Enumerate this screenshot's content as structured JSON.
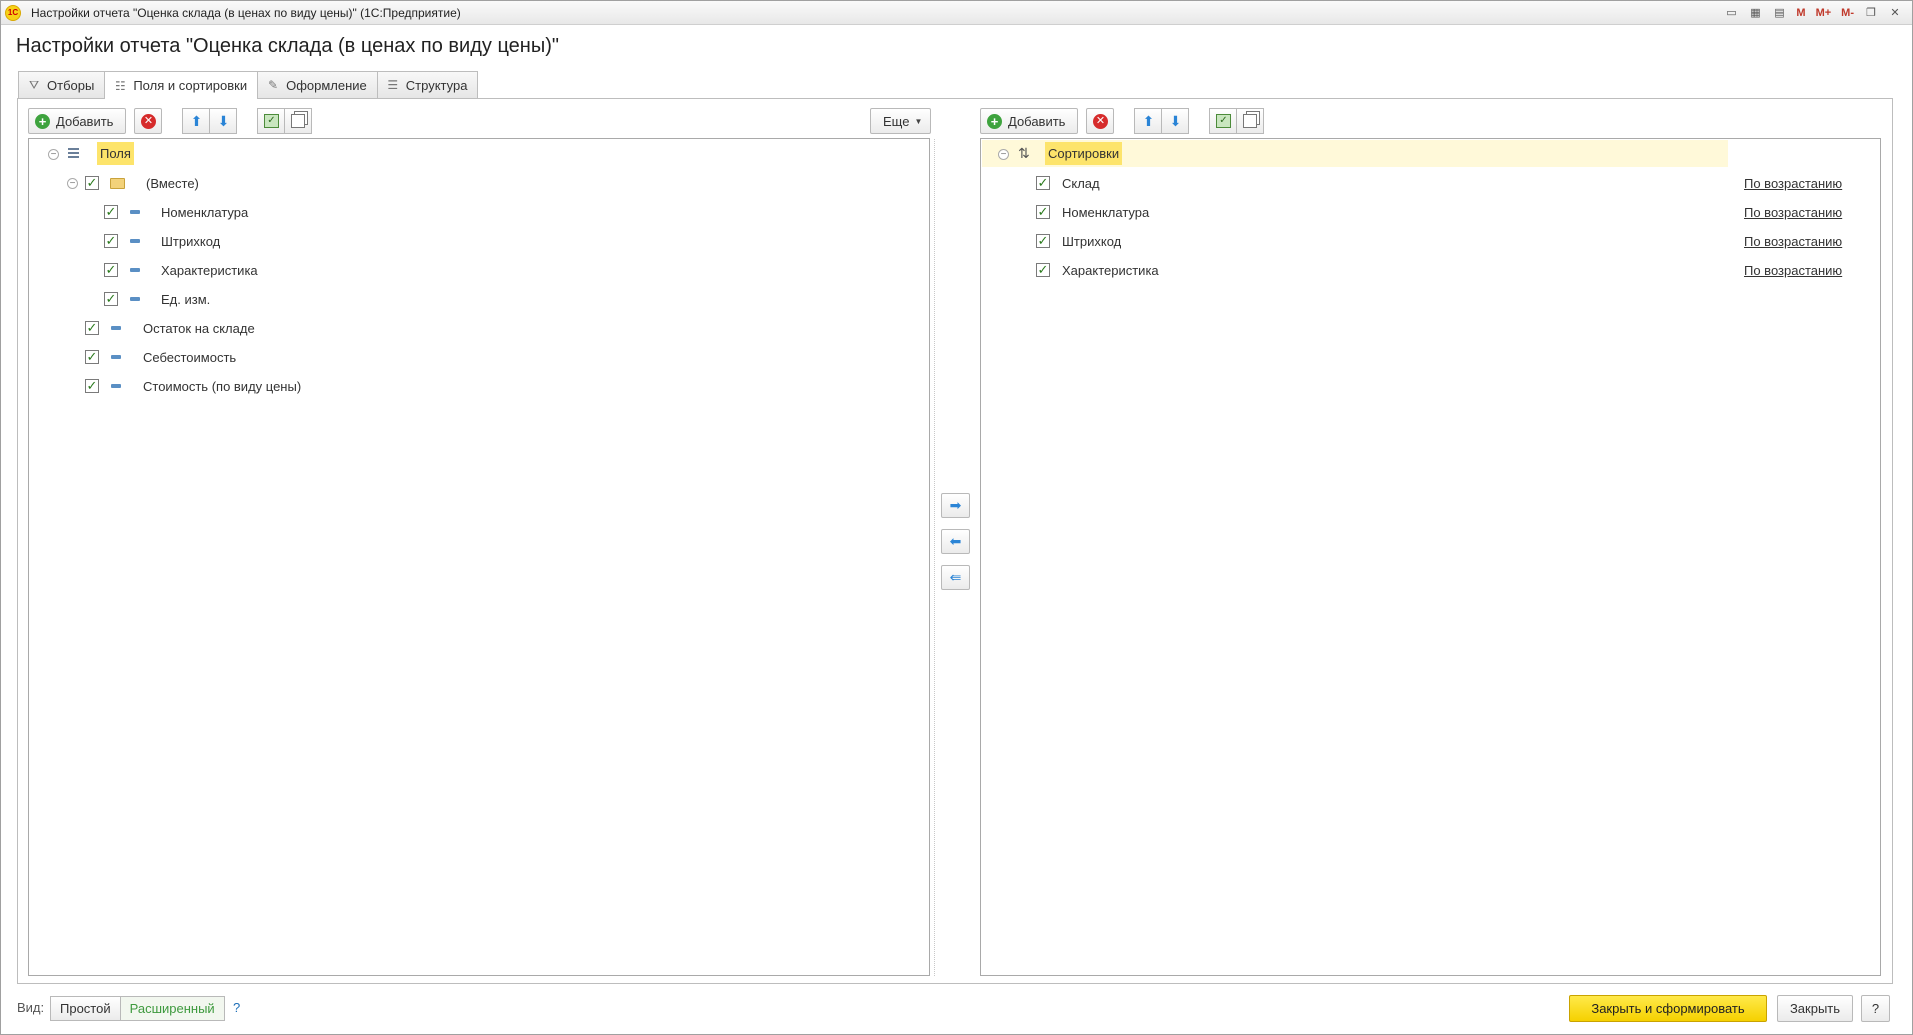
{
  "window": {
    "app_logo": "1С",
    "title": "Настройки отчета \"Оценка склада (в ценах по виду цены)\"  (1С:Предприятие)",
    "tools": [
      "doc-icon",
      "calc-icon",
      "calendar-icon"
    ],
    "mem_buttons": [
      "M",
      "M+",
      "M-"
    ]
  },
  "page": {
    "title": "Настройки отчета \"Оценка склада (в ценах по виду цены)\""
  },
  "tabs": [
    {
      "label": "Отборы",
      "icon": "filter-icon",
      "active": false
    },
    {
      "label": "Поля и сортировки",
      "icon": "fields-icon",
      "active": true
    },
    {
      "label": "Оформление",
      "icon": "brush-icon",
      "active": false
    },
    {
      "label": "Структура",
      "icon": "structure-icon",
      "active": false
    }
  ],
  "left_toolbar": {
    "add_label": "Добавить",
    "more_label": "Еще"
  },
  "right_toolbar": {
    "add_label": "Добавить"
  },
  "fields_tree": {
    "root_label": "Поля",
    "group_label": "(Вместе)",
    "group_items": [
      "Номенклатура",
      "Штрихкод",
      "Характеристика",
      "Ед. изм."
    ],
    "items": [
      "Остаток на складе",
      "Себестоимость",
      "Стоимость (по виду цены)"
    ]
  },
  "sort_tree": {
    "root_label": "Сортировки",
    "items": [
      {
        "label": "Склад",
        "order": "По возрастанию"
      },
      {
        "label": "Номенклатура",
        "order": "По возрастанию"
      },
      {
        "label": "Штрихкод",
        "order": "По возрастанию"
      },
      {
        "label": "Характеристика",
        "order": "По возрастанию"
      }
    ]
  },
  "footer": {
    "view_label": "Вид:",
    "simple_label": "Простой",
    "extended_label": "Расширенный",
    "help_link": "?",
    "primary_label": "Закрыть и сформировать",
    "close_label": "Закрыть",
    "help_label": "?"
  },
  "colors": {
    "accent_yellow": "#f5d100",
    "selected_green": "#3e9a3e",
    "root_highlight": "#fde46b"
  }
}
